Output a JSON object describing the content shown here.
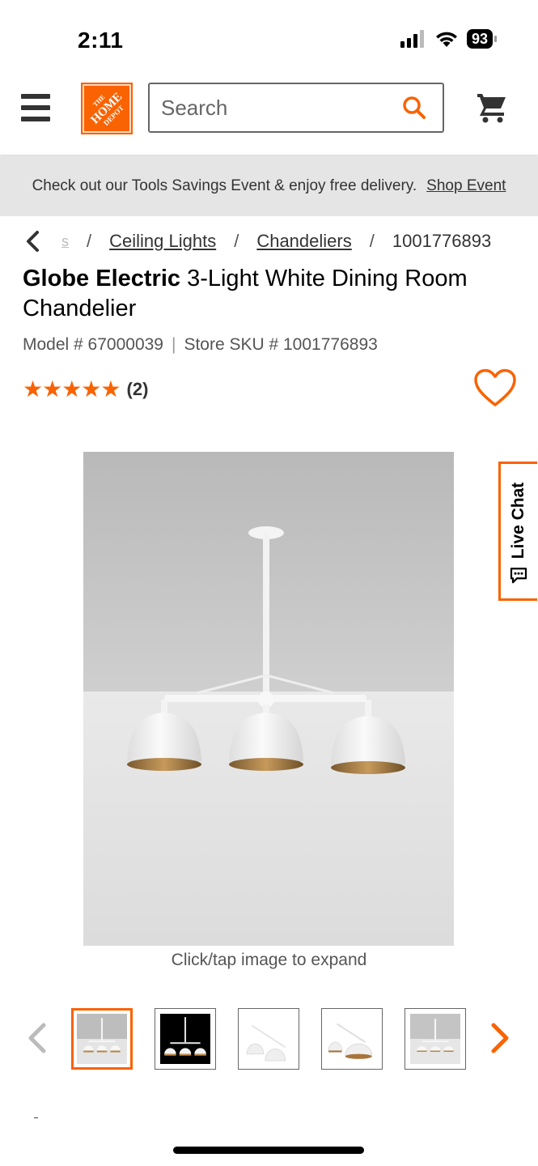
{
  "status_bar": {
    "time": "2:11",
    "battery": "93"
  },
  "header": {
    "search_placeholder": "Search",
    "logo_text": "THE HOME DEPOT",
    "icons": [
      "menu-icon",
      "search-icon",
      "cart-icon"
    ]
  },
  "promo": {
    "text": "Check out our Tools Savings Event & enjoy free delivery.",
    "link": "Shop Event"
  },
  "breadcrumb": {
    "faded": "s",
    "items": [
      "Ceiling Lights",
      "Chandeliers",
      "1001776893"
    ],
    "separator": "/"
  },
  "product": {
    "brand": "Globe Electric",
    "name": "3-Light White Dining Room Chandelier",
    "model": "Model # 67000039",
    "sku": "Store SKU # 1001776893",
    "stars": "★★★★★",
    "rating": 5,
    "review_count": "(2)"
  },
  "gallery": {
    "caption": "Click/tap image to expand",
    "thumbnail_count": 5,
    "active_index": 0
  },
  "live_chat": {
    "label": "Live Chat"
  },
  "colors": {
    "accent": "#f96302",
    "promo_bg": "#e5e5e5",
    "text": "#333333"
  }
}
